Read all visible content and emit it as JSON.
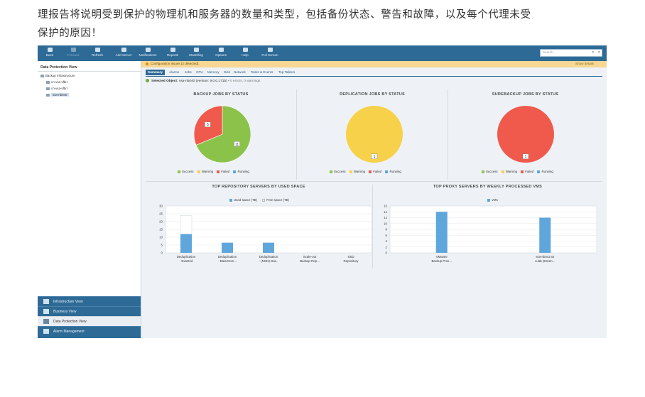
{
  "article": {
    "line1": "理报告将说明受到保护的物理机和服务器的数量和类型，包括备份状态、警告和故障，以及每个代理未受",
    "line2": "保护的原因！"
  },
  "toolbar": {
    "buttons": [
      "Back",
      "Forward",
      "Refresh",
      "Add Server",
      "Notifications",
      "Reports",
      "Modelling",
      "Options",
      "Help",
      "Full Screen"
    ],
    "search_placeholder": "Search..."
  },
  "left_panel": {
    "title": "Data Protection View",
    "tree": [
      "Backup Infrastructure",
      "cn-vsa-vfbrr",
      "cn-vsa-vfbrr",
      "ssa-nb040"
    ],
    "nav": [
      "Infrastructure View",
      "Business View",
      "Data Protection View",
      "Alarm Management"
    ]
  },
  "banner": {
    "text": "Configuration issues (2 detected).",
    "show": "Show details"
  },
  "tabs": [
    "Summary",
    "Alarms",
    "Jobs",
    "CPU",
    "Memory",
    "Disk",
    "Network",
    "Tasks & Events",
    "Top Talkers"
  ],
  "selected": {
    "label": "Selected Object:",
    "name": "ssa-nb040",
    "version": "(version: 9.0.0.1715)",
    "status": "• 0 errors, 0 warnings"
  },
  "colors": {
    "success": "#8bc34a",
    "warning": "#f7d14a",
    "failed": "#ef5a4c",
    "running": "#5fa6dd"
  },
  "pie_legend": [
    "Success",
    "Warning",
    "Failed",
    "Running"
  ],
  "chart_data": [
    {
      "type": "pie",
      "title": "BACKUP JOBS BY STATUS",
      "categories": [
        "Success",
        "Warning",
        "Failed",
        "Running"
      ],
      "values": [
        11,
        0,
        5,
        0
      ]
    },
    {
      "type": "pie",
      "title": "REPLICATION JOBS BY STATUS",
      "categories": [
        "Success",
        "Warning",
        "Failed",
        "Running"
      ],
      "values": [
        0,
        1,
        0,
        0
      ]
    },
    {
      "type": "pie",
      "title": "SUREBACKUP JOBS BY STATUS",
      "categories": [
        "Success",
        "Warning",
        "Failed",
        "Running"
      ],
      "values": [
        0,
        0,
        1,
        0
      ]
    },
    {
      "type": "bar",
      "title": "TOP REPOSITORY SERVERS BY USED SPACE",
      "categories": [
        [
          "Deduplication",
          "- ExaGrid"
        ],
        [
          "Deduplication",
          "- Data Dom..."
        ],
        [
          "Deduplication",
          "- (NON) Dat..."
        ],
        [
          "Scale-out",
          "Backup Rep..."
        ],
        [
          "SSD",
          "Repository"
        ]
      ],
      "series": [
        {
          "name": "Used space (TB)",
          "values": [
            12,
            6.5,
            6.5,
            0,
            0
          ]
        },
        {
          "name": "Free space (TB)",
          "values": [
            12,
            0,
            0,
            0,
            0
          ]
        }
      ],
      "ylim": [
        0,
        30
      ],
      "yticks": [
        0,
        5,
        10,
        15,
        20,
        25,
        30
      ]
    },
    {
      "type": "bar",
      "title": "TOP PROXY SERVERS BY WEEKLY PROCESSED VMS",
      "categories": [
        [
          "VMware",
          "Backup Prox..."
        ],
        [
          "ssa-nb042.ss",
          "a.lab (Essen..."
        ]
      ],
      "series": [
        {
          "name": "VMs",
          "values": [
            14,
            12
          ]
        }
      ],
      "ylim": [
        0,
        16
      ],
      "yticks": [
        0,
        2,
        4,
        6,
        8,
        10,
        12,
        14,
        16
      ]
    }
  ]
}
